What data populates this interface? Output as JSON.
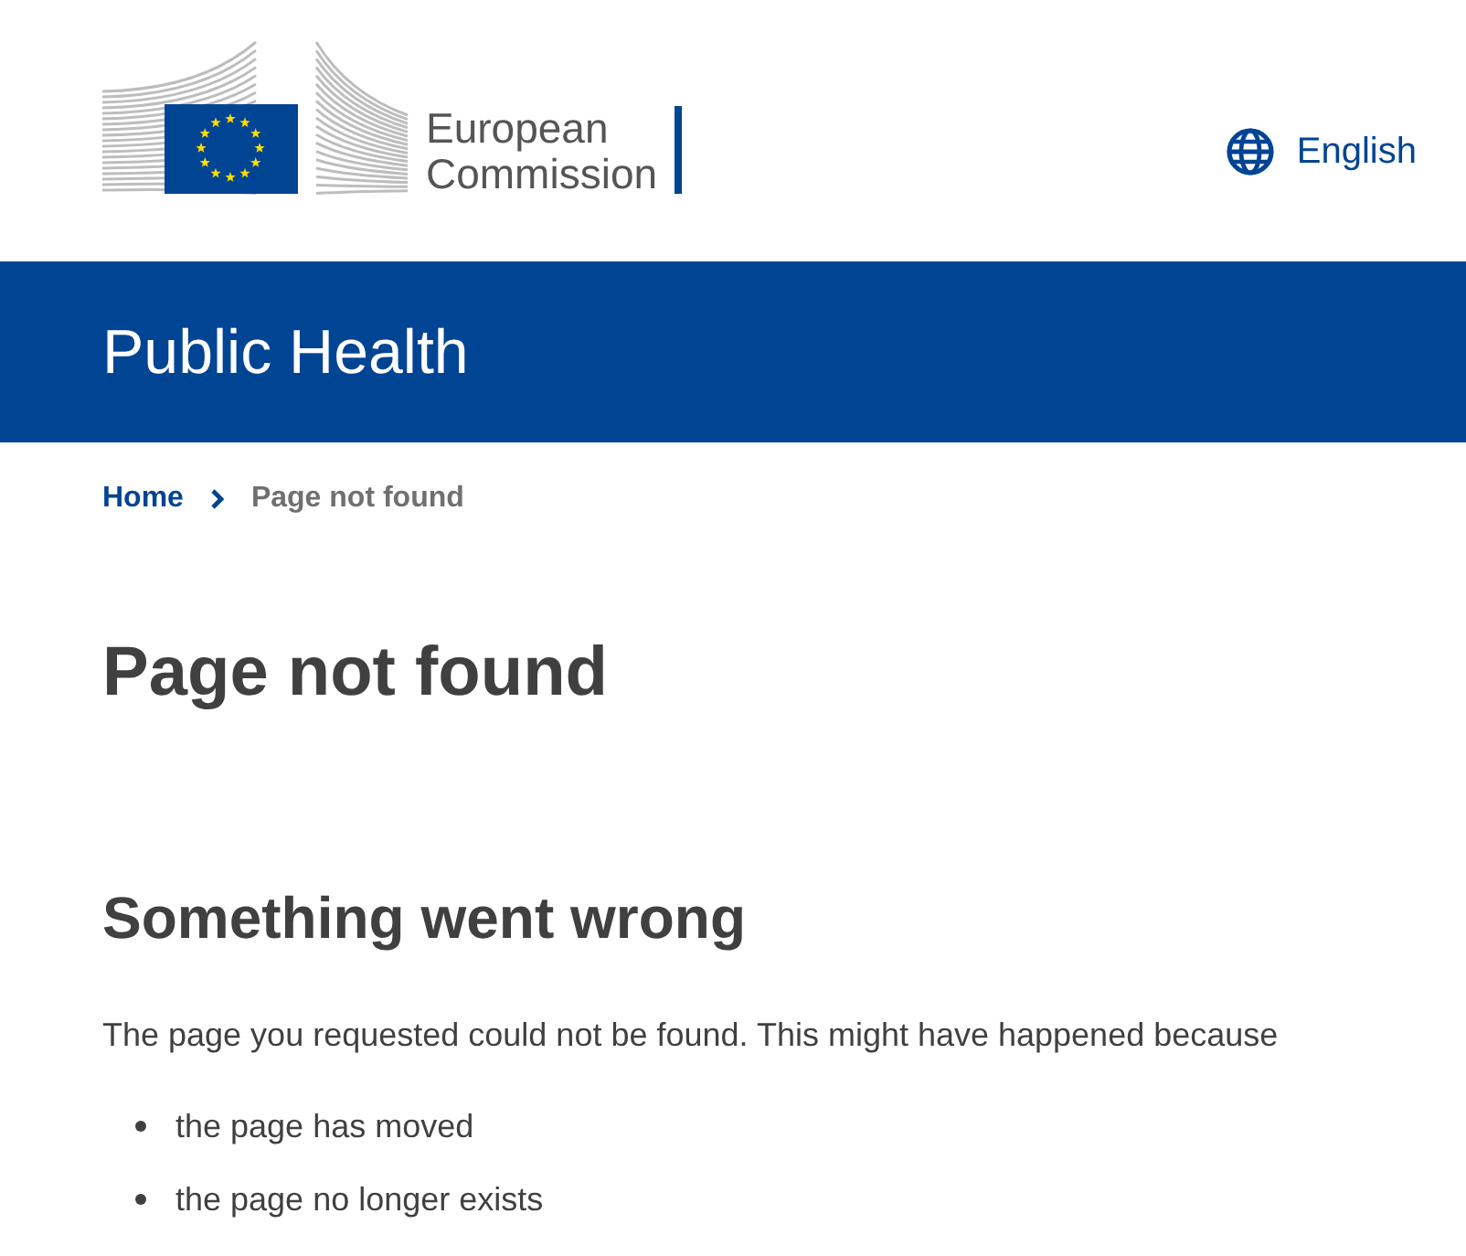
{
  "header": {
    "logo_text": "European Commission",
    "language": "English"
  },
  "banner": {
    "title": "Public Health"
  },
  "breadcrumb": [
    {
      "label": "Home",
      "current": false
    },
    {
      "label": "Page not found",
      "current": true
    }
  ],
  "page_title": "Page not found",
  "content": {
    "heading": "Something went wrong",
    "intro": "The page you requested could not be found. This might have happened because",
    "reasons": [
      "the page has moved",
      "the page no longer exists"
    ]
  }
}
